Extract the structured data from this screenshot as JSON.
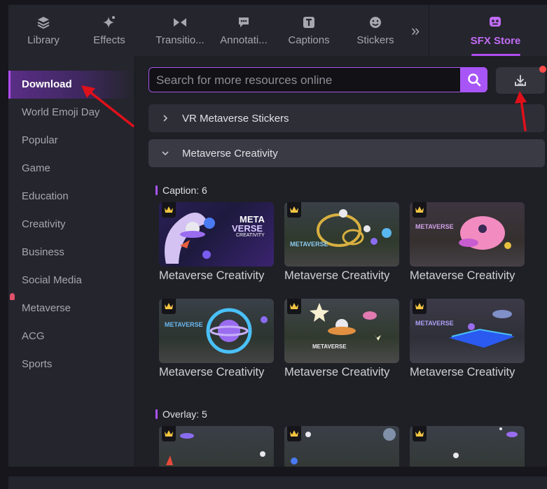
{
  "tabs": [
    {
      "label": "Library",
      "icon": "layers-icon"
    },
    {
      "label": "Effects",
      "icon": "sparkle-icon"
    },
    {
      "label": "Transitio...",
      "icon": "transition-icon"
    },
    {
      "label": "Annotati...",
      "icon": "annotation-icon"
    },
    {
      "label": "Captions",
      "icon": "captions-icon"
    },
    {
      "label": "Stickers",
      "icon": "sticker-icon"
    }
  ],
  "more_label": "»",
  "sfx_store": {
    "label": "SFX Store",
    "icon": "store-icon"
  },
  "sidebar": {
    "items": [
      "Download",
      "World Emoji Day",
      "Popular",
      "Game",
      "Education",
      "Creativity",
      "Business",
      "Social Media",
      "Metaverse",
      "ACG",
      "Sports"
    ],
    "active": "Download"
  },
  "search": {
    "placeholder": "Search for more resources online",
    "value": ""
  },
  "sections": [
    {
      "label": "VR Metaverse Stickers",
      "expanded": false
    },
    {
      "label": "Metaverse Creativity",
      "expanded": true
    }
  ],
  "categories": [
    {
      "label": "Caption: 6",
      "items": [
        "Metaverse Creativity",
        "Metaverse Creativity",
        "Metaverse Creativity",
        "Metaverse Creativity",
        "Metaverse Creativity",
        "Metaverse Creativity"
      ]
    },
    {
      "label": "Overlay: 5",
      "items": [
        "",
        "",
        ""
      ]
    }
  ],
  "thumb_text": {
    "meta": "META",
    "verse": "VERSE",
    "creativity": "CREATIVITY",
    "metaverse": "METAVERSE"
  },
  "colors": {
    "accent": "#a855f7",
    "badge": "#ff4a4a",
    "crown": "#f4c542",
    "annotation_arrow": "#e0101a"
  }
}
